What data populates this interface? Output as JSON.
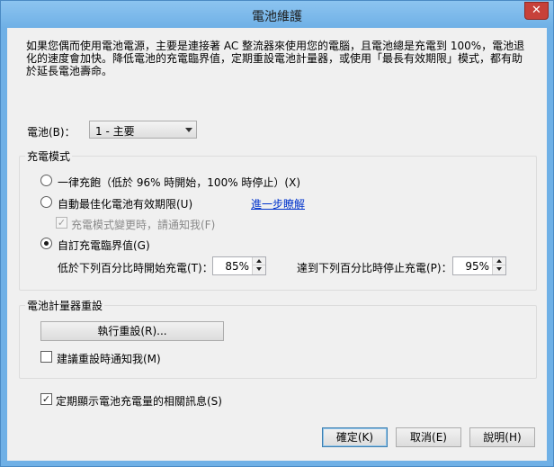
{
  "window": {
    "title": "電池維護",
    "close_glyph": "✕"
  },
  "intro_text": "如果您偶而使用電池電源，主要是連接著 AC 整流器來使用您的電腦，且電池總是充電到 100%，電池退化的速度會加快。降低電池的充電臨界值，定期重設電池計量器，或使用「最長有效期限」模式，都有助於延長電池壽命。",
  "battery": {
    "label": "電池(B)：",
    "selected": "1 - 主要"
  },
  "charge_mode": {
    "group_title": "充電模式",
    "option_full": "一律充飽（低於 96% 時開始，100% 時停止）(X)",
    "option_auto": "自動最佳化電池有效期限(U)",
    "learn_more": "進一步瞭解",
    "notify_change": "充電模式變更時，請通知我(F)",
    "notify_checked_glyph": "✓",
    "option_custom": "自訂充電臨界值(G)",
    "start_label": "低於下列百分比時開始充電(T)：",
    "start_value": "85%",
    "stop_label": "達到下列百分比時停止充電(P)：",
    "stop_value": "95%",
    "selected_option": "custom"
  },
  "gauge_reset": {
    "group_title": "電池計量器重設",
    "reset_button": "執行重設(R)...",
    "notify_reset": "建議重設時通知我(M)",
    "notify_reset_checked": false
  },
  "show_info": {
    "label": "定期顯示電池充電量的相關訊息(S)",
    "checked_glyph": "✓"
  },
  "buttons": {
    "ok": "確定(K)",
    "cancel": "取消(E)",
    "help": "說明(H)"
  }
}
